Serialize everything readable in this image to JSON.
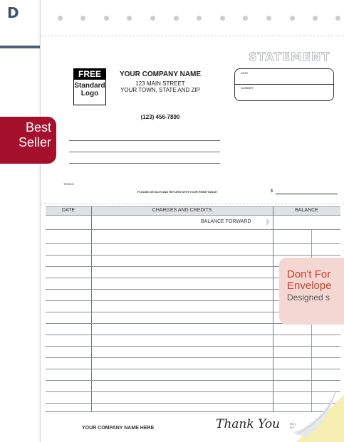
{
  "corner_letter": "D",
  "badge": {
    "line1": "Best",
    "line2": "Seller"
  },
  "promo": {
    "line1": "Don't For",
    "line2": "Envelope",
    "line3": "Designed s"
  },
  "form": {
    "title": "STATEMENT",
    "date_label": "DATE",
    "number_label": "NUMBER",
    "logo": {
      "free": "FREE",
      "text_line1": "Standard",
      "text_line2": "Logo"
    },
    "company": {
      "name": "YOUR COMPANY NAME",
      "street": "123 MAIN STREET",
      "city": "YOUR TOWN, STATE AND ZIP",
      "phone": "(123) 456-7890"
    },
    "terms_label": "TERMS:",
    "detach_text": "PLEASE DETACH AND RETURN WITH YOUR REMITTANCE",
    "dollar_sign": "$",
    "columns": {
      "date": "DATE",
      "charges": "CHARGES AND CREDITS",
      "balance": "BALANCE"
    },
    "balance_forward": "BALANCE FORWARD",
    "footer_company": "YOUR COMPANY NAME HERE",
    "thank_you": "Thank You",
    "tiny_text": {
      "line1": "PAY L",
      "line2": "IN T"
    }
  },
  "colors": {
    "badge": "#a5102c",
    "promo_bg": "#f4d7d3",
    "promo_text": "#c8402b",
    "header_fill": "#dde2e6",
    "accent": "#4a6276",
    "carbon_yellow": "#f6efb0",
    "carbon_pink": "#f7d2d8"
  }
}
